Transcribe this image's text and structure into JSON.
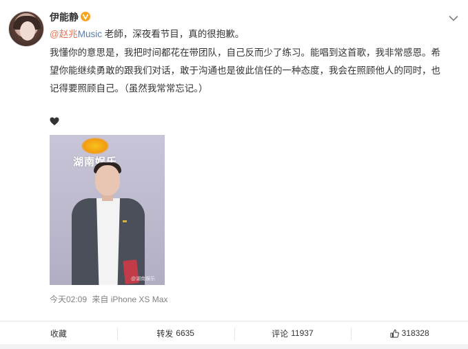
{
  "author": {
    "name": "伊能静",
    "verified_icon": "verified-v-badge",
    "verified_color": "#f7a51c"
  },
  "post": {
    "mention": "@赵兆",
    "mention_suffix": "Music",
    "line1_rest": " 老師，深夜看节目，真的很抱歉。",
    "line2": "我懂你的意思是，我把时间都花在带团队，自己反而少了练习。能唱到这首歌，我非常感恩。希",
    "line3": "望你能继续勇敢的跟我们对话，敢于沟通也是彼此信任的一种态度，我会在照顾他人的同时，也",
    "line4": "记得要照顾自己。（虽然我常常忘记。）",
    "emoji": "heart-icon"
  },
  "media": {
    "logo_text": "湖南娱乐",
    "watermark": "@湖南娱乐"
  },
  "meta": {
    "time": "今天02:09",
    "source": "来自 iPhone XS Max"
  },
  "actions": {
    "favorite": "收藏",
    "repost_label": "转发",
    "repost_count": "6635",
    "comment_label": "评论",
    "comment_count": "11937",
    "like_count": "318328"
  },
  "colors": {
    "mention": "#eb7350",
    "link": "#5b7ca6",
    "meta": "#808080"
  }
}
